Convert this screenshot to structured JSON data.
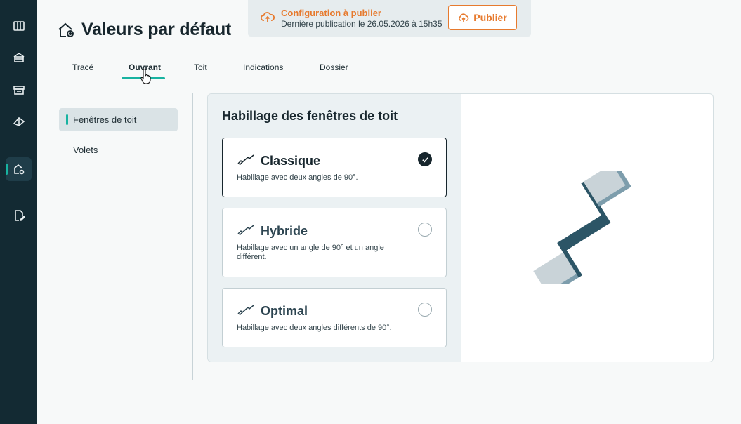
{
  "sidebar_rail": {
    "items": [
      {
        "icon": "plan-icon"
      },
      {
        "icon": "house-icon"
      },
      {
        "icon": "store-icon"
      },
      {
        "icon": "roof-icon"
      },
      {
        "icon": "house-settings-icon",
        "active": true
      },
      {
        "icon": "document-edit-icon"
      }
    ]
  },
  "header": {
    "title": "Valeurs par défaut",
    "title_icon": "house-settings-icon"
  },
  "publish": {
    "title": "Configuration à publier",
    "subtitle": "Dernière publication le 26.05.2026 à 15h35",
    "button_label": "Publier",
    "accent": "#e77a2e"
  },
  "tabs": [
    {
      "label": "Tracé"
    },
    {
      "label": "Ouvrant",
      "active": true
    },
    {
      "label": "Toit"
    },
    {
      "label": "Indications"
    },
    {
      "label": "Dossier"
    }
  ],
  "subnav": {
    "items": [
      {
        "label": "Fenêtres de toit",
        "active": true
      },
      {
        "label": "Volets"
      }
    ]
  },
  "panel": {
    "title": "Habillage des fenêtres de toit",
    "options": [
      {
        "name": "Classique",
        "description": "Habillage avec deux angles de 90°.",
        "selected": true
      },
      {
        "name": "Hybride",
        "description": "Habillage avec un angle de 90° et un angle différent.",
        "selected": false
      },
      {
        "name": "Optimal",
        "description": "Habillage avec deux angles différents de 90°.",
        "selected": false
      }
    ]
  },
  "colors": {
    "rail_bg": "#132a33",
    "accent_teal": "#18b3a1",
    "illustration_dark": "#2c5566",
    "illustration_light": "#c9d3d8"
  }
}
